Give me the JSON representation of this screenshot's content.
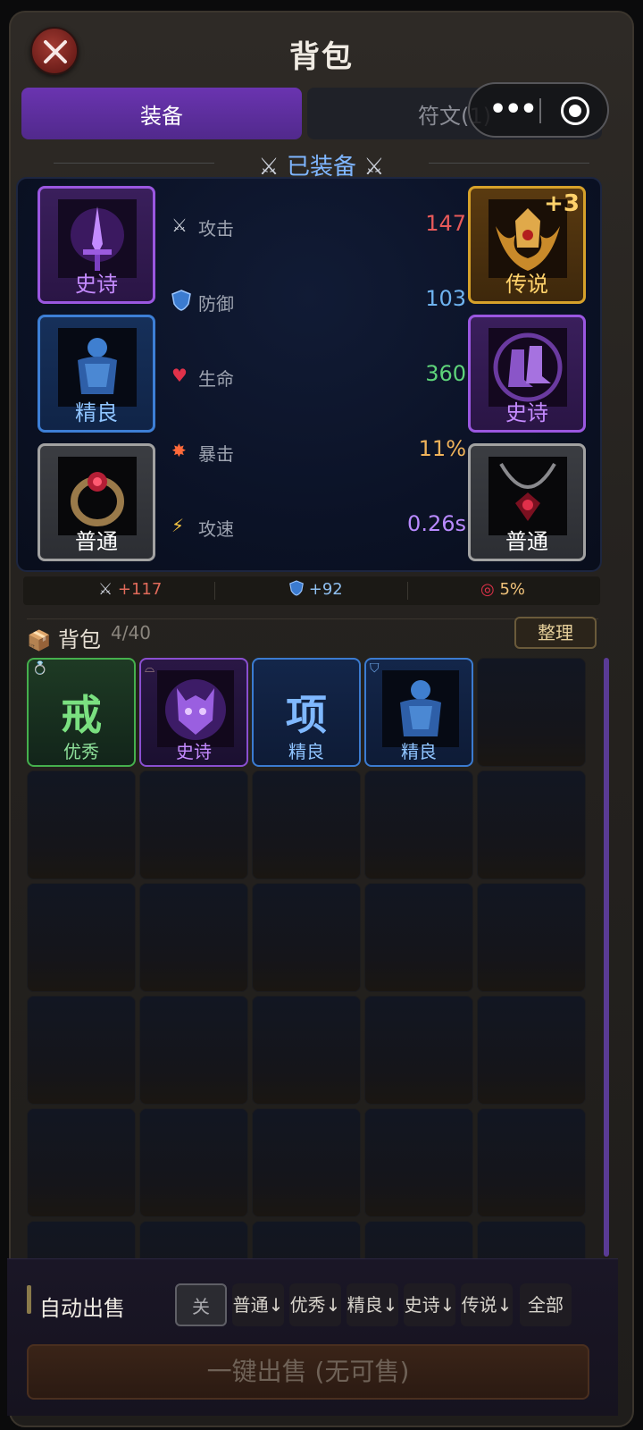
{
  "header": {
    "title": "背包"
  },
  "tabs": [
    {
      "label": "装备",
      "active": true
    },
    {
      "label": "符文(1)",
      "active": false
    }
  ],
  "equipped": {
    "title": "已装备",
    "slots": [
      {
        "quality": "史诗",
        "icon": "sword-icon"
      },
      {
        "quality": "传说",
        "icon": "helmet-icon",
        "enhance": "+3"
      },
      {
        "quality": "精良",
        "icon": "armor-icon"
      },
      {
        "quality": "史诗",
        "icon": "boots-icon"
      },
      {
        "quality": "普通",
        "icon": "ring-icon"
      },
      {
        "quality": "普通",
        "icon": "necklace-icon"
      }
    ],
    "stats": [
      {
        "name": "攻击",
        "value": "147",
        "icon": "swords-icon",
        "color": "#e85a5a"
      },
      {
        "name": "防御",
        "value": "103",
        "icon": "shield-icon",
        "color": "#6fb3f0"
      },
      {
        "name": "生命",
        "value": "360",
        "icon": "heart-icon",
        "color": "#5ed37a"
      },
      {
        "name": "暴击",
        "value": "11%",
        "icon": "burst-icon",
        "color": "#f0b35a"
      },
      {
        "name": "攻速",
        "value": "0.26s",
        "icon": "lightning-icon",
        "color": "#b98aff"
      }
    ]
  },
  "bonus": {
    "attack": "+117",
    "defense": "+92",
    "crit": "5%"
  },
  "bag": {
    "title": "背包",
    "count": "4/40",
    "sort_label": "整理",
    "items": [
      {
        "glyph": "戒",
        "quality": "优秀"
      },
      {
        "glyph": "",
        "quality": "史诗"
      },
      {
        "glyph": "项",
        "quality": "精良"
      },
      {
        "glyph": "",
        "quality": "精良"
      }
    ]
  },
  "auto_sell": {
    "label": "自动出售",
    "options": [
      "关",
      "普通↓",
      "优秀↓",
      "精良↓",
      "史诗↓",
      "传说↓",
      "全部"
    ],
    "sell_button": "一键出售 (无可售)"
  },
  "colors": {
    "epic": "#9a57e0",
    "legend": "#d6a12a",
    "fine": "#3d7fd6",
    "common": "#a2a2a2",
    "good": "#45b04d",
    "accent": "#6a34b0"
  }
}
